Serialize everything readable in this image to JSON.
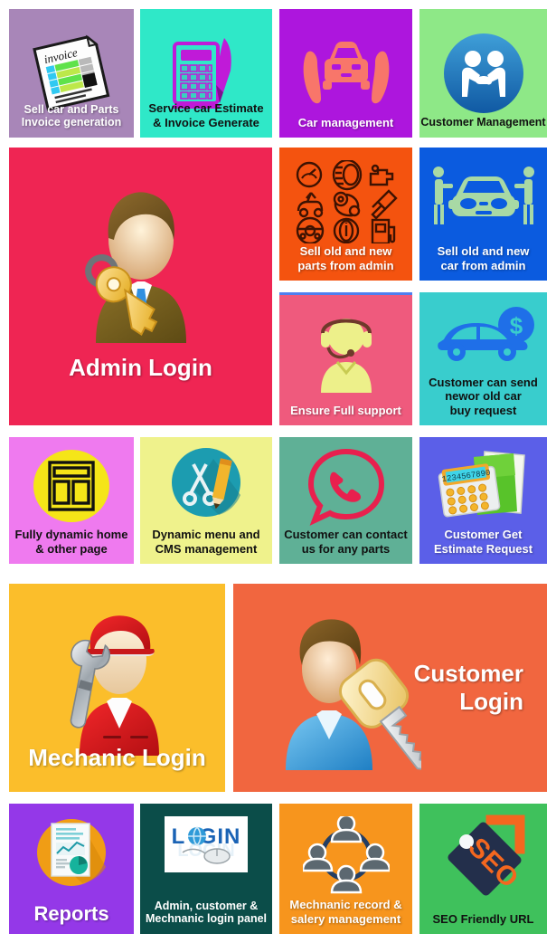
{
  "page": {
    "title": "Car Service & Sales Management System Feature Tiles",
    "columns": 4,
    "rows": 5
  },
  "tiles": [
    {
      "id": "invoice",
      "label": "Sell car and Parts\nInvoice generation",
      "bg": "#a886b8",
      "text_color": "#ffffff",
      "icon": "invoice-document-icon"
    },
    {
      "id": "service",
      "label": "Service car Estimate\n& Invoice Generate",
      "bg": "#2fe8c8",
      "text_color": "#111111",
      "icon": "calculator-pen-icon"
    },
    {
      "id": "carmgmt",
      "label": "Car management",
      "bg": "#ad16dd",
      "text_color": "#ffffff",
      "icon": "car-in-hands-icon"
    },
    {
      "id": "custmgmt",
      "label": "Customer Management",
      "bg": "#8ee887",
      "text_color": "#111111",
      "icon": "handshake-circle-icon"
    },
    {
      "id": "admin",
      "label": "Admin Login",
      "bg": "#ef2553",
      "text_color": "#ffffff",
      "icon": "admin-user-key-icon"
    },
    {
      "id": "parts",
      "label": "Sell old and new\nparts from admin",
      "bg": "#f4530f",
      "text_color": "#ffffff",
      "icon": "auto-parts-grid-icon"
    },
    {
      "id": "carsell",
      "label": "Sell old and new\ncar from admin",
      "bg": "#0b5bdf",
      "text_color": "#ffffff",
      "icon": "car-handover-icon"
    },
    {
      "id": "support",
      "label": "Ensure Full support",
      "bg": "#ef5a7d",
      "text_color": "#ffffff",
      "icon": "headset-agent-icon",
      "top_border": "#4f7ff0"
    },
    {
      "id": "buyreq",
      "label": "Customer can send\nnewor old car\nbuy request",
      "bg": "#39cdcd",
      "text_color": "#111111",
      "icon": "car-dollar-icon"
    },
    {
      "id": "dynhome",
      "label": "Fully dynamic home\n& other page",
      "bg": "#ef7aef",
      "text_color": "#111111",
      "icon": "layout-page-icon"
    },
    {
      "id": "cms",
      "label": "Dynamic menu and\nCMS management",
      "bg": "#eff28c",
      "text_color": "#111111",
      "icon": "scissors-pencil-icon"
    },
    {
      "id": "contact",
      "label": "Customer can contact\nus for any parts",
      "bg": "#5fb096",
      "text_color": "#111111",
      "icon": "whatsapp-chat-icon"
    },
    {
      "id": "estimate",
      "label": "Customer Get\nEstimate Request",
      "bg": "#5b5fe8",
      "text_color": "#ffffff",
      "icon": "calculator-folder-icon"
    },
    {
      "id": "mech",
      "label": "Mechanic Login",
      "bg": "#fbbe2b",
      "text_color": "#ffffff",
      "icon": "mechanic-wrench-icon"
    },
    {
      "id": "cust",
      "label": "Customer\nLogin",
      "bg": "#f1663f",
      "text_color": "#ffffff",
      "icon": "customer-key-icon"
    },
    {
      "id": "reports",
      "label": "Reports",
      "bg": "#9438e8",
      "text_color": "#ffffff",
      "icon": "report-chart-icon"
    },
    {
      "id": "loginp",
      "label": "Admin, customer &\nMechnanic login panel",
      "bg": "#0b4d49",
      "text_color": "#ffffff",
      "icon": "login-globe-mouse-icon",
      "icon_text": "LOGIN"
    },
    {
      "id": "mechrec",
      "label": "Mechnanic record &\nsalery management",
      "bg": "#f7951d",
      "text_color": "#ffffff",
      "icon": "team-network-icon"
    },
    {
      "id": "seo",
      "label": "SEO Friendly URL",
      "bg": "#3fc15c",
      "text_color": "#111111",
      "icon": "seo-tag-icon",
      "icon_text": "SEO"
    }
  ]
}
